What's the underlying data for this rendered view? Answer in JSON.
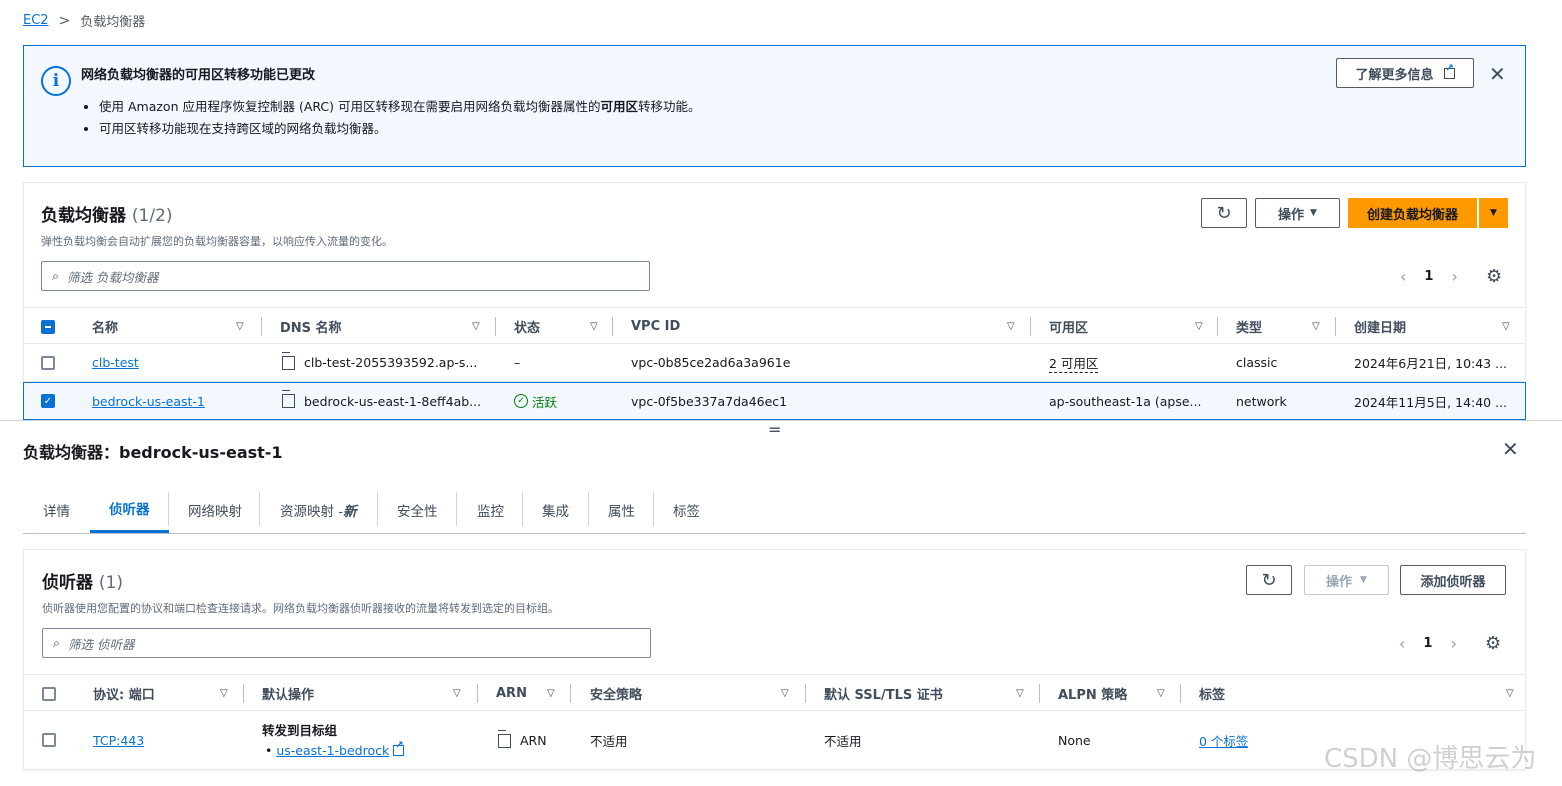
{
  "breadcrumb": {
    "root": "EC2",
    "sep": ">",
    "current": "负载均衡器"
  },
  "banner": {
    "title": "网络负载均衡器的可用区转移功能已更改",
    "bullet1_pre": "使用 Amazon 应用程序恢复控制器 (ARC) 可用区转移现在需要启用网络负载均衡器属性的",
    "bullet1_bold": "可用区",
    "bullet1_post": "转移功能。",
    "bullet2": "可用区转移功能现在支持跨区域的网络负载均衡器。",
    "learn_more": "了解更多信息",
    "close": "✕"
  },
  "lb_panel": {
    "title": "负载均衡器",
    "count": "(1/2)",
    "description": "弹性负载均衡会自动扩展您的负载均衡器容量，以响应传入流量的变化。",
    "actions_label": "操作",
    "create_label": "创建负载均衡器",
    "search_placeholder": "筛选 负载均衡器",
    "page": "1",
    "columns": [
      "名称",
      "DNS 名称",
      "状态",
      "VPC ID",
      "可用区",
      "类型",
      "创建日期"
    ],
    "rows": [
      {
        "name": "clb-test",
        "dns": "clb-test-2055393592.ap-s...",
        "state": "–",
        "vpc": "vpc-0b85ce2ad6a3a961e",
        "az": "2 可用区",
        "type": "classic",
        "created": "2024年6月21日, 10:43 ..."
      },
      {
        "name": "bedrock-us-east-1",
        "dns": "bedrock-us-east-1-8eff4ab...",
        "state": "活跃",
        "vpc": "vpc-0f5be337a7da46ec1",
        "az": "ap-southeast-1a (apse...",
        "type": "network",
        "created": "2024年11月5日, 14:40 ..."
      }
    ]
  },
  "split_handle": "=",
  "detail": {
    "title": "负载均衡器：bedrock-us-east-1",
    "close": "✕",
    "tabs": [
      "详情",
      "侦听器",
      "网络映射",
      "资源映射 - ",
      "安全性",
      "监控",
      "集成",
      "属性",
      "标签"
    ],
    "tab_new": "新"
  },
  "listener_panel": {
    "title": "侦听器",
    "count": "(1)",
    "description": "侦听器使用您配置的协议和端口检查连接请求。网络负载均衡器侦听器接收的流量将转发到选定的目标组。",
    "actions_label": "操作",
    "add_label": "添加侦听器",
    "search_placeholder": "筛选 侦听器",
    "page": "1",
    "columns": [
      "协议: 端口",
      "默认操作",
      "ARN",
      "安全策略",
      "默认 SSL/TLS 证书",
      "ALPN 策略",
      "标签"
    ],
    "row": {
      "protocol": "TCP:443",
      "action_title": "转发到目标组",
      "target_group": "us-east-1-bedrock",
      "arn": "ARN",
      "security_policy": "不适用",
      "certificate": "不适用",
      "alpn": "None",
      "tags": "0 个标签"
    }
  },
  "watermark": "CSDN @博思云为",
  "colors": {
    "accent": "#0972d3",
    "primary_button": "#ff9900",
    "success": "#037f0c"
  }
}
